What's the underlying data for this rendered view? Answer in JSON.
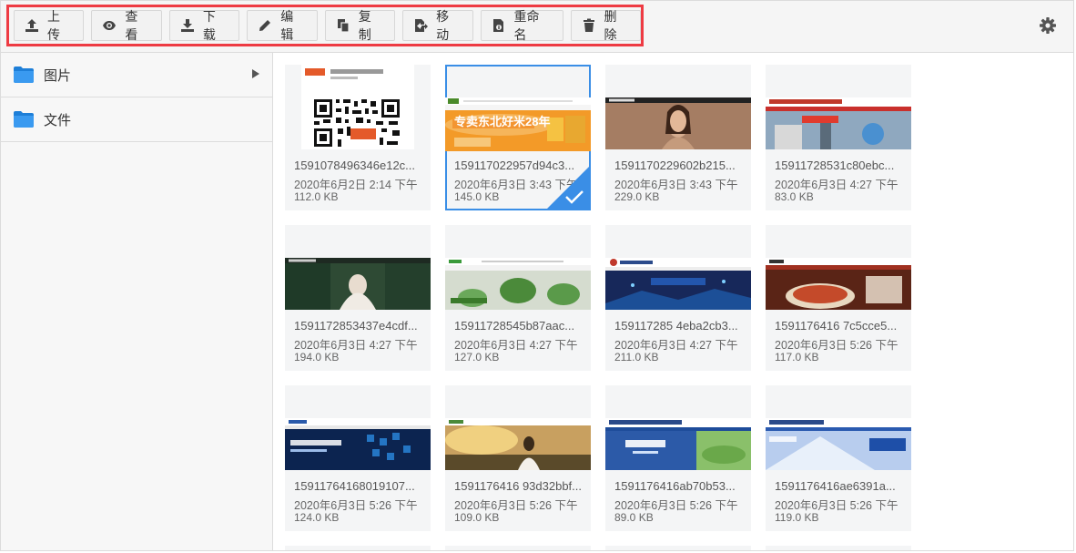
{
  "toolbar": {
    "buttons": [
      {
        "label": "上传",
        "icon": "upload-icon"
      },
      {
        "label": "查看",
        "icon": "eye-icon"
      },
      {
        "label": "下载",
        "icon": "download-icon"
      },
      {
        "label": "编辑",
        "icon": "pencil-icon"
      },
      {
        "label": "复制",
        "icon": "copy-icon"
      },
      {
        "label": "移动",
        "icon": "move-icon"
      },
      {
        "label": "重命名",
        "icon": "rename-icon"
      },
      {
        "label": "删除",
        "icon": "trash-icon"
      }
    ],
    "settings_icon": "gear-icon",
    "highlight_color": "#ee3b43"
  },
  "sidebar": {
    "items": [
      {
        "label": "图片",
        "icon": "folder-icon",
        "expandable": true
      },
      {
        "label": "文件",
        "icon": "folder-icon",
        "expandable": false
      }
    ],
    "folder_color": "#2b8ce6"
  },
  "files": [
    {
      "name": "1591078496346e12c...",
      "date": "2020年6月2日 2:14 下午",
      "size": "112.0 KB",
      "selected": false
    },
    {
      "name": "159117022957d94c3...",
      "date": "2020年6月3日 3:43 下午",
      "size": "145.0 KB",
      "selected": true
    },
    {
      "name": "1591170229602b215...",
      "date": "2020年6月3日 3:43 下午",
      "size": "229.0 KB",
      "selected": false
    },
    {
      "name": "15911728531c80ebc...",
      "date": "2020年6月3日 4:27 下午",
      "size": "83.0 KB",
      "selected": false
    },
    {
      "name": "1591172853437e4cdf...",
      "date": "2020年6月3日 4:27 下午",
      "size": "194.0 KB",
      "selected": false
    },
    {
      "name": "15911728545b87aac...",
      "date": "2020年6月3日 4:27 下午",
      "size": "127.0 KB",
      "selected": false
    },
    {
      "name": "159117285 4eba2cb3...",
      "date": "2020年6月3日 4:27 下午",
      "size": "211.0 KB",
      "selected": false
    },
    {
      "name": "1591176416 7c5cce5...",
      "date": "2020年6月3日 5:26 下午",
      "size": "117.0 KB",
      "selected": false
    },
    {
      "name": "15911764168019107...",
      "date": "2020年6月3日 5:26 下午",
      "size": "124.0 KB",
      "selected": false
    },
    {
      "name": "1591176416 93d32bbf...",
      "date": "2020年6月3日 5:26 下午",
      "size": "109.0 KB",
      "selected": false
    },
    {
      "name": "1591176416ab70b53...",
      "date": "2020年6月3日 5:26 下午",
      "size": "89.0 KB",
      "selected": false
    },
    {
      "name": "1591176416ae6391a...",
      "date": "2020年6月3日 5:26 下午",
      "size": "119.0 KB",
      "selected": false
    }
  ],
  "selected_color": "#3a8ee6"
}
